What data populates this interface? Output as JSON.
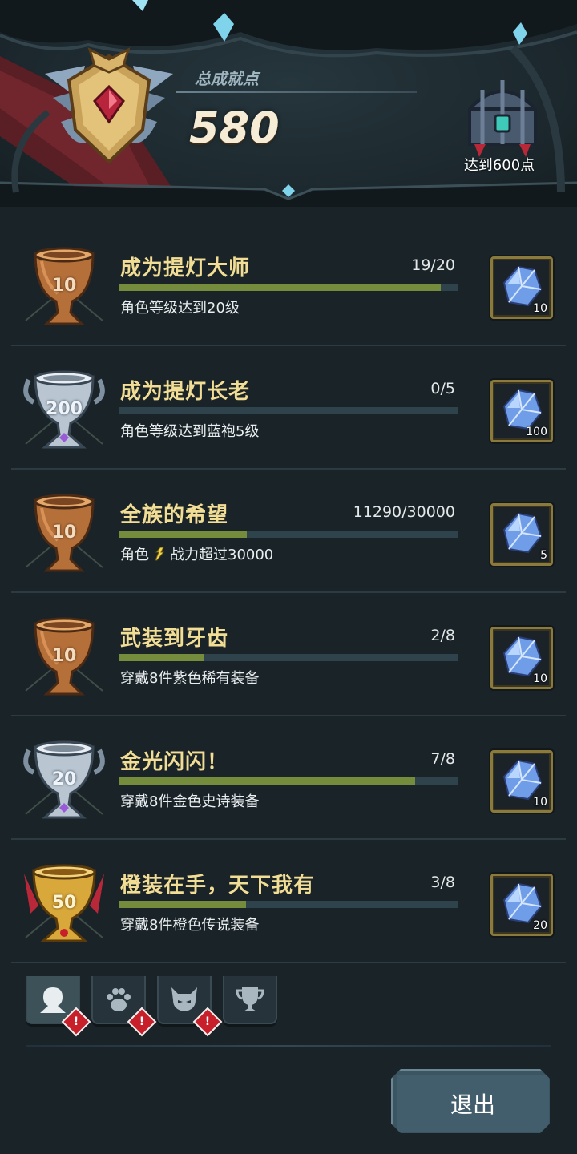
{
  "header": {
    "total_label": "总成就点",
    "total_points": "580",
    "next_reward_label": "达到600点"
  },
  "achievements": [
    {
      "title": "成为提灯大师",
      "progress": "19/20",
      "fill": 0.95,
      "desc": "角色等级达到20级",
      "trophy": "bronze",
      "trophy_value": "10",
      "reward_count": "10"
    },
    {
      "title": "成为提灯长老",
      "progress": "0/5",
      "fill": 0.0,
      "desc": "角色等级达到蓝袍5级",
      "trophy": "silver",
      "trophy_value": "200",
      "reward_count": "100"
    },
    {
      "title": "全族的希望",
      "progress": "11290/30000",
      "fill": 0.376,
      "desc_prefix": "角色",
      "desc": "战力超过30000",
      "trophy": "bronze",
      "trophy_value": "10",
      "reward_count": "5"
    },
    {
      "title": "武装到牙齿",
      "progress": "2/8",
      "fill": 0.25,
      "desc": "穿戴8件紫色稀有装备",
      "trophy": "bronze",
      "trophy_value": "10",
      "reward_count": "10"
    },
    {
      "title": "金光闪闪！",
      "progress": "7/8",
      "fill": 0.875,
      "desc": "穿戴8件金色史诗装备",
      "trophy": "silver",
      "trophy_value": "20",
      "reward_count": "10"
    },
    {
      "title": "橙装在手，天下我有",
      "progress": "3/8",
      "fill": 0.375,
      "desc": "穿戴8件橙色传说装备",
      "trophy": "gold",
      "trophy_value": "50",
      "reward_count": "20"
    }
  ],
  "tabs": [
    {
      "icon": "character-icon",
      "alert": true
    },
    {
      "icon": "paw-icon",
      "alert": true
    },
    {
      "icon": "monster-icon",
      "alert": true
    },
    {
      "icon": "trophy-icon",
      "alert": false
    }
  ],
  "exit_label": "退出",
  "colors": {
    "title": "#f2dd94",
    "bar_fill": "#748c3c",
    "bar_track": "#2f434d",
    "alert": "#c8202a",
    "bronze": "#b5703a",
    "silver": "#b9c6d2",
    "gold": "#d8a83a"
  }
}
